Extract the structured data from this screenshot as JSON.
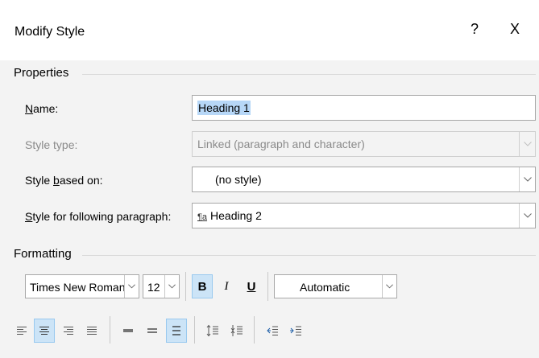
{
  "dialog": {
    "title": "Modify Style",
    "help": "?",
    "close": "X"
  },
  "properties": {
    "heading": "Properties",
    "name_label": "Name:",
    "name_value": "Heading 1",
    "style_type_label": "Style type:",
    "style_type_value": "Linked (paragraph and character)",
    "based_on_label": "Style based on:",
    "based_on_value": "(no style)",
    "following_label": "Style for following paragraph:",
    "following_value": "Heading 2",
    "following_icon": "¶a"
  },
  "formatting": {
    "heading": "Formatting",
    "font": "Times New Roman",
    "size": "12",
    "bold": "B",
    "italic": "I",
    "underline": "U",
    "color": "Automatic",
    "active_buttons": [
      "bold",
      "align-center",
      "line-spacing-double"
    ]
  },
  "colors": {
    "selection": "#b7d7f7",
    "toggle_active": "#cce4f7",
    "toggle_border": "#99c9ef",
    "background": "#f3f3f3"
  }
}
